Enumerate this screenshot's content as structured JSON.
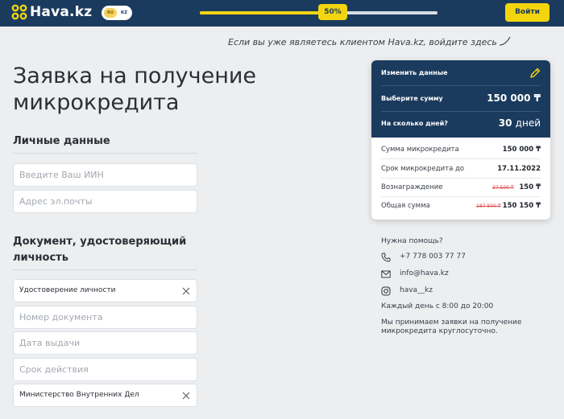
{
  "header": {
    "brand": "Hava.kz",
    "lang": {
      "ru": "RU",
      "kz": "KZ"
    },
    "progress": {
      "label": "50%",
      "value": 0.5
    },
    "login_label": "Войти"
  },
  "login_hint": "Если вы уже являетесь клиентом Hava.kz, войдите здесь",
  "title": "Заявка на получение микрокредита",
  "personal": {
    "title": "Личные данные",
    "iin_placeholder": "Введите Ваш ИИН",
    "email_placeholder": "Адрес эл.почты"
  },
  "document": {
    "title": "Документ, удостоверяющий личность",
    "doc_type_value": "Удостоверение личности",
    "doc_number_placeholder": "Номер документа",
    "issue_date_placeholder": "Дата выдачи",
    "expiry_placeholder": "Срок действия",
    "issuer_value": "Министерство Внутренних Дел"
  },
  "summary": {
    "edit_label": "Изменить данные",
    "amount_q": "Выберите сумму",
    "amount_a": "150 000 ₸",
    "days_q": "На сколько дней?",
    "days_num": "30",
    "days_unit": "дней",
    "rows": [
      {
        "label": "Сумма микрокредита",
        "value": "150 000 ₸",
        "old": ""
      },
      {
        "label": "Срок микрокредита до",
        "value": "17.11.2022",
        "old": ""
      },
      {
        "label": "Вознаграждение",
        "value": "150 ₸",
        "old": "37 500 ₸"
      },
      {
        "label": "Общая сумма",
        "value": "150 150 ₸",
        "old": "187 500 ₸"
      }
    ]
  },
  "help": {
    "title": "Нужна помощь?",
    "phone": "+7 778 003 77 77",
    "email": "info@hava.kz",
    "instagram": "hava__kz",
    "hours": "Каждый день с 8:00 до 20:00",
    "note": "Мы принимаем заявки на получение микрокредита круглосуточно."
  },
  "colors": {
    "primary": "#1b3b5e",
    "accent": "#f2d50f",
    "strike": "#e0474c"
  }
}
